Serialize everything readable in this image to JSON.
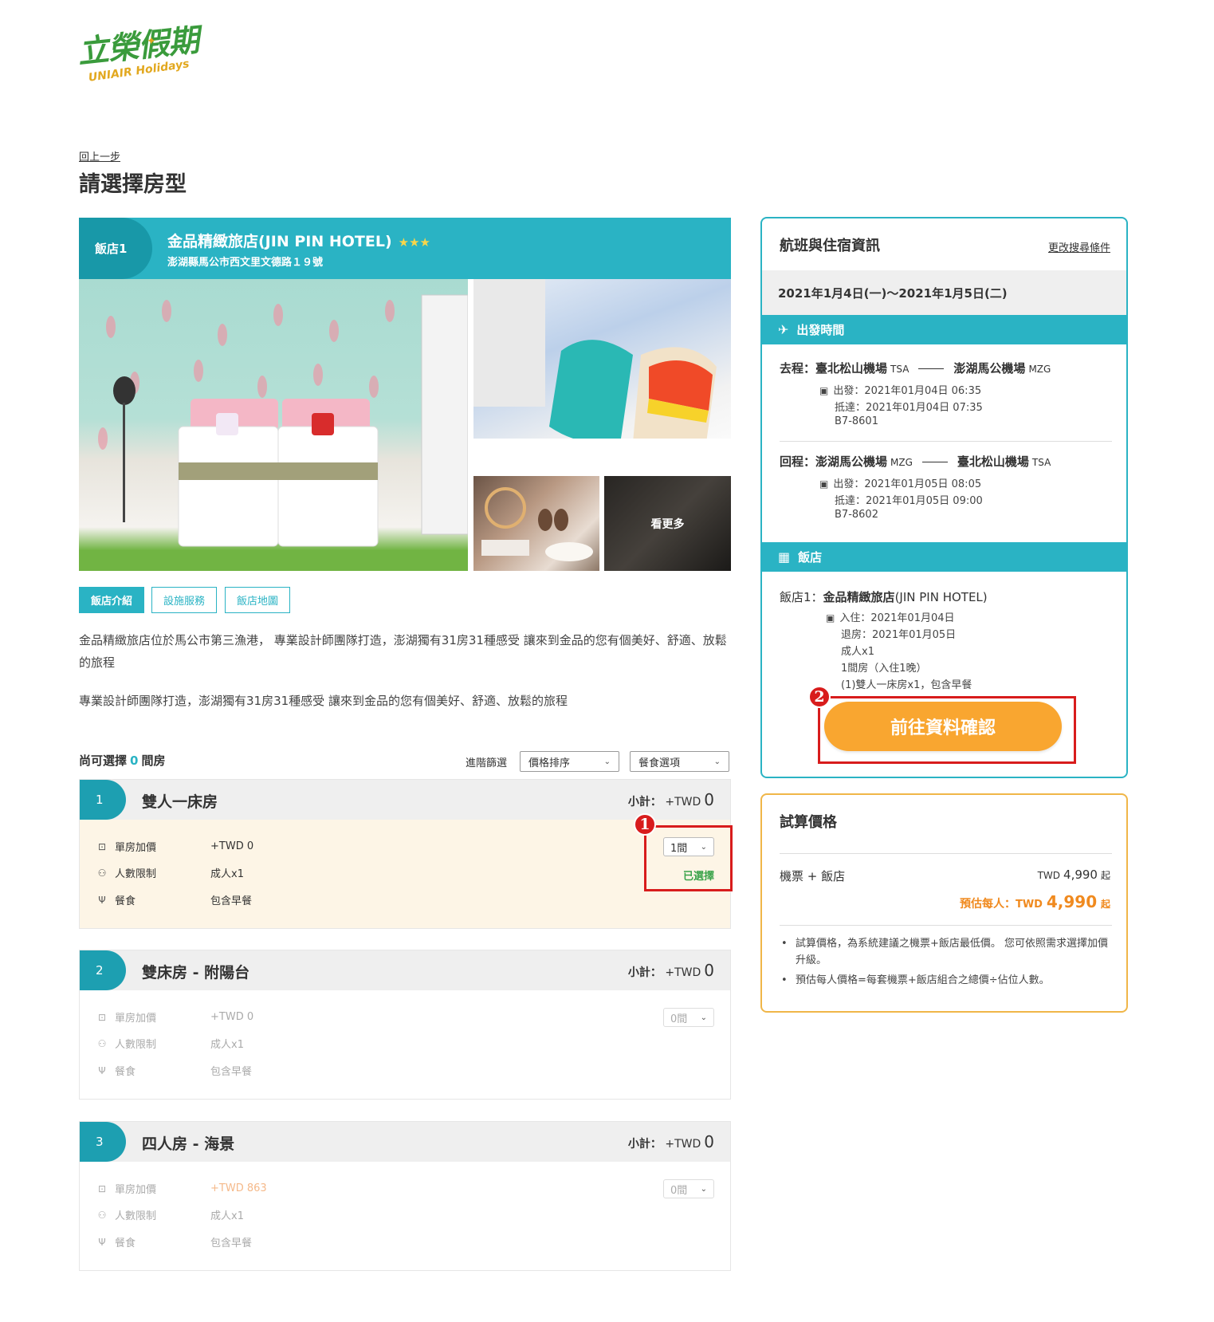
{
  "brand": {
    "logo_zh": "立榮假期",
    "logo_en": "UNIAIR Holidays"
  },
  "nav": {
    "back_label": "回上一步"
  },
  "page_title": "請選擇房型",
  "hotel": {
    "tag": "飯店1",
    "name": "金品精緻旅店(JIN PIN HOTEL)",
    "stars": "★★★",
    "address": "澎湖縣馬公市西文里文德路１９號",
    "more_photos_label": "看更多",
    "tabs": [
      "飯店介紹",
      "設施服務",
      "飯店地圖"
    ],
    "description_1": "金品精緻旅店位於馬公市第三漁港， 專業設計師團隊打造，澎湖獨有31房31種感受 讓來到金品的您有個美好、舒適、放鬆的旅程",
    "description_2": "專業設計師團隊打造，澎湖獨有31房31種感受 讓來到金品的您有個美好、舒適、放鬆的旅程"
  },
  "rooms_header": {
    "available_prefix": "尚可選擇",
    "available_count": "0",
    "available_suffix": "間房",
    "filter_label": "進階篩選",
    "sort_select": "價格排序",
    "meal_select": "餐食選項"
  },
  "rooms": [
    {
      "num": "1",
      "name": "雙人一床房",
      "subtotal_label": "小計：",
      "subtotal_cur": "+TWD",
      "subtotal_val": "0",
      "surcharge_label": "單房加價",
      "surcharge_val": "+TWD  0",
      "people_label": "人數限制",
      "people_val": "成人x1",
      "meal_label": "餐食",
      "meal_val": "包含早餐",
      "qty": "1間",
      "selected_label": "已選擇"
    },
    {
      "num": "2",
      "name": "雙床房 - 附陽台",
      "subtotal_label": "小計：",
      "subtotal_cur": "+TWD",
      "subtotal_val": "0",
      "surcharge_label": "單房加價",
      "surcharge_val": "+TWD  0",
      "people_label": "人數限制",
      "people_val": "成人x1",
      "meal_label": "餐食",
      "meal_val": "包含早餐",
      "qty": "0間"
    },
    {
      "num": "3",
      "name": "四人房 - 海景",
      "subtotal_label": "小計：",
      "subtotal_cur": "+TWD",
      "subtotal_val": "0",
      "surcharge_label": "單房加價",
      "surcharge_val": "+TWD  863",
      "people_label": "人數限制",
      "people_val": "成人x1",
      "meal_label": "餐食",
      "meal_val": "包含早餐",
      "qty": "0間"
    }
  ],
  "annotations": {
    "badge_1": "1",
    "badge_2": "2"
  },
  "info_panel": {
    "title": "航班與住宿資訊",
    "change_link": "更改搜尋條件",
    "dates": "2021年1月4日(一)～2021年1月5日(二)",
    "flight_section": "出發時間",
    "outbound": {
      "prefix": "去程：",
      "from": "臺北松山機場",
      "from_code": "TSA",
      "to": "澎湖馬公機場",
      "to_code": "MZG",
      "depart": "出發：2021年01月04日 06:35",
      "arrive": "抵達：2021年01月04日 07:35",
      "flight_no": "B7-8601"
    },
    "inbound": {
      "prefix": "回程：",
      "from": "澎湖馬公機場",
      "from_code": "MZG",
      "to": "臺北松山機場",
      "to_code": "TSA",
      "depart": "出發：2021年01月05日 08:05",
      "arrive": "抵達：2021年01月05日 09:00",
      "flight_no": "B7-8602"
    },
    "hotel_section": "飯店",
    "hotel_line_prefix": "飯店1：",
    "hotel_line_name": "金品精緻旅店",
    "hotel_line_en": "(JIN PIN HOTEL)",
    "checkin": "入住：2021年01月04日",
    "checkout": "退房：2021年01月05日",
    "guests": "成人x1",
    "rooms": "1間房（入住1晚）",
    "room_detail": "(1)雙人一床房x1，包含早餐",
    "confirm_button": "前往資料確認"
  },
  "price_panel": {
    "title": "試算價格",
    "row_label": "機票 + 飯店",
    "row_cur": "TWD",
    "row_val": "4,990",
    "row_qi": "起",
    "per_person_label": "預估每人：",
    "per_person_cur": "TWD",
    "per_person_val": "4,990",
    "per_person_qi": "起",
    "notes": [
      "試算價格，為系統建議之機票+飯店最低價。 您可依照需求選擇加價升級。",
      "預估每人價格=每套機票+飯店組合之總價÷佔位人數。"
    ]
  },
  "colors": {
    "teal": "#2ab3c4",
    "teal_dark": "#1898a8",
    "orange": "#f9a630",
    "red": "#d81c1c",
    "selected_bg": "#fdf5e6"
  }
}
